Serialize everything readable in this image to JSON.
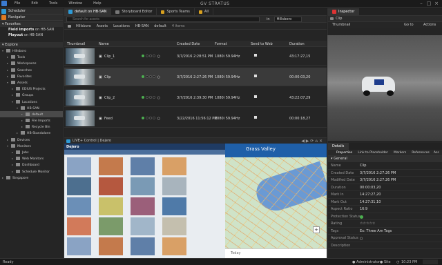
{
  "menu": [
    "File",
    "Edit",
    "Tools",
    "Window",
    "Help"
  ],
  "app_title": "GV STRATUS",
  "left": {
    "scheduler_tab": "Scheduler",
    "navigator_tab": "Navigator",
    "favorites_label": "Favorites",
    "favorites": [
      {
        "name": "Field imports",
        "suffix": " on HB-SAN"
      },
      {
        "name": "Playout",
        "suffix": " on HB-SAN"
      }
    ],
    "explore_label": "Explore",
    "tree": [
      {
        "indent": 0,
        "label": "Hillsboro",
        "open": true
      },
      {
        "indent": 1,
        "label": "Tools",
        "open": false
      },
      {
        "indent": 1,
        "label": "Workspaces",
        "open": false
      },
      {
        "indent": 1,
        "label": "Searches",
        "open": false
      },
      {
        "indent": 1,
        "label": "Favorites",
        "open": false
      },
      {
        "indent": 1,
        "label": "Assets",
        "open": true
      },
      {
        "indent": 2,
        "label": "EDIUS Projects",
        "open": false
      },
      {
        "indent": 2,
        "label": "Groups",
        "open": false
      },
      {
        "indent": 2,
        "label": "Locations",
        "open": true
      },
      {
        "indent": 3,
        "label": "HB-SAN",
        "open": true
      },
      {
        "indent": 4,
        "label": "default",
        "open": false,
        "selected": true
      },
      {
        "indent": 4,
        "label": "File Imports",
        "open": false
      },
      {
        "indent": 4,
        "label": "Recycle Bin",
        "open": false
      },
      {
        "indent": 3,
        "label": "HB-Standalone",
        "open": false
      },
      {
        "indent": 1,
        "label": "Devices",
        "open": false
      },
      {
        "indent": 1,
        "label": "Monitors",
        "open": true
      },
      {
        "indent": 2,
        "label": "Jobs",
        "open": false
      },
      {
        "indent": 2,
        "label": "Web Monitors",
        "open": false
      },
      {
        "indent": 2,
        "label": "Dashboard",
        "open": false
      },
      {
        "indent": 2,
        "label": "Schedule Monitor",
        "open": false
      },
      {
        "indent": 0,
        "label": "Singapore",
        "open": false
      }
    ]
  },
  "center": {
    "tabs": [
      "default on HB-SAN",
      "Storyboard Editor",
      "Sports Teams",
      "All"
    ],
    "search_placeholder": "Search for assets",
    "search_in": "in",
    "search_scope": "Hillsboro",
    "breadcrumbs": [
      "Hillsboro",
      "Assets",
      "Locations",
      "HB-SAN",
      "default"
    ],
    "item_count": "4 items",
    "columns": [
      "Thumbnail",
      "Name",
      "",
      "Created Date",
      "Format",
      "Send to Web",
      "Duration"
    ],
    "rows": [
      {
        "name": "Clip_1",
        "date": "3/7/2016 2:28:51 PM",
        "format": "1080i 59.94Hz",
        "duration": "43:17:27,15"
      },
      {
        "name": "Clip",
        "date": "3/7/2016 2:27:26 PM",
        "format": "1080i 59.94Hz",
        "duration": "00:00:03,20"
      },
      {
        "name": "Clip_2",
        "date": "3/7/2016 2:39:30 PM",
        "format": "1080i 59.94Hz",
        "duration": "43:22:07,29"
      },
      {
        "name": "Feed",
        "date": "3/22/2016 11:56:12 PM",
        "format": "1080i 59.94Hz",
        "duration": "00:00:18,27"
      }
    ],
    "viewer_tab": "LIVE+ Control | Dejero",
    "viewer_logo": "Dejero",
    "map_title": "Grass Valley",
    "map_footer": "Today"
  },
  "inspector": {
    "tab": "Inspector",
    "clip_name": "Clip",
    "thumbnail_tab": "Thumbnail",
    "go_to": "Go to",
    "actions": "Actions",
    "details_tab": "Details",
    "prop_tabs": [
      "Properties",
      "Link to Placeholder",
      "Markers",
      "References",
      "Ass"
    ],
    "general_label": "General",
    "fields": [
      {
        "k": "Name",
        "v": "Clip"
      },
      {
        "k": "Created Date",
        "v": "3/7/2016 2:27:26 PM"
      },
      {
        "k": "Modified Date",
        "v": "3/7/2016 2:27:26 PM"
      },
      {
        "k": "Duration",
        "v": "00:00:03,20"
      },
      {
        "k": "Mark In",
        "v": "14:27:27,20"
      },
      {
        "k": "Mark Out",
        "v": "14:27:31,10"
      },
      {
        "k": "Aspect Ratio",
        "v": "16:9"
      },
      {
        "k": "Protection Status",
        "v": ""
      },
      {
        "k": "Rating",
        "v": "☆☆☆☆☆"
      },
      {
        "k": "Tags",
        "v": "Ex: Three Am Tags"
      },
      {
        "k": "Approval Status",
        "v": ""
      },
      {
        "k": "Description",
        "v": ""
      }
    ]
  },
  "status": {
    "left": "Ready",
    "user": "Administrator",
    "site": "Site",
    "time": "10:23 PM"
  }
}
